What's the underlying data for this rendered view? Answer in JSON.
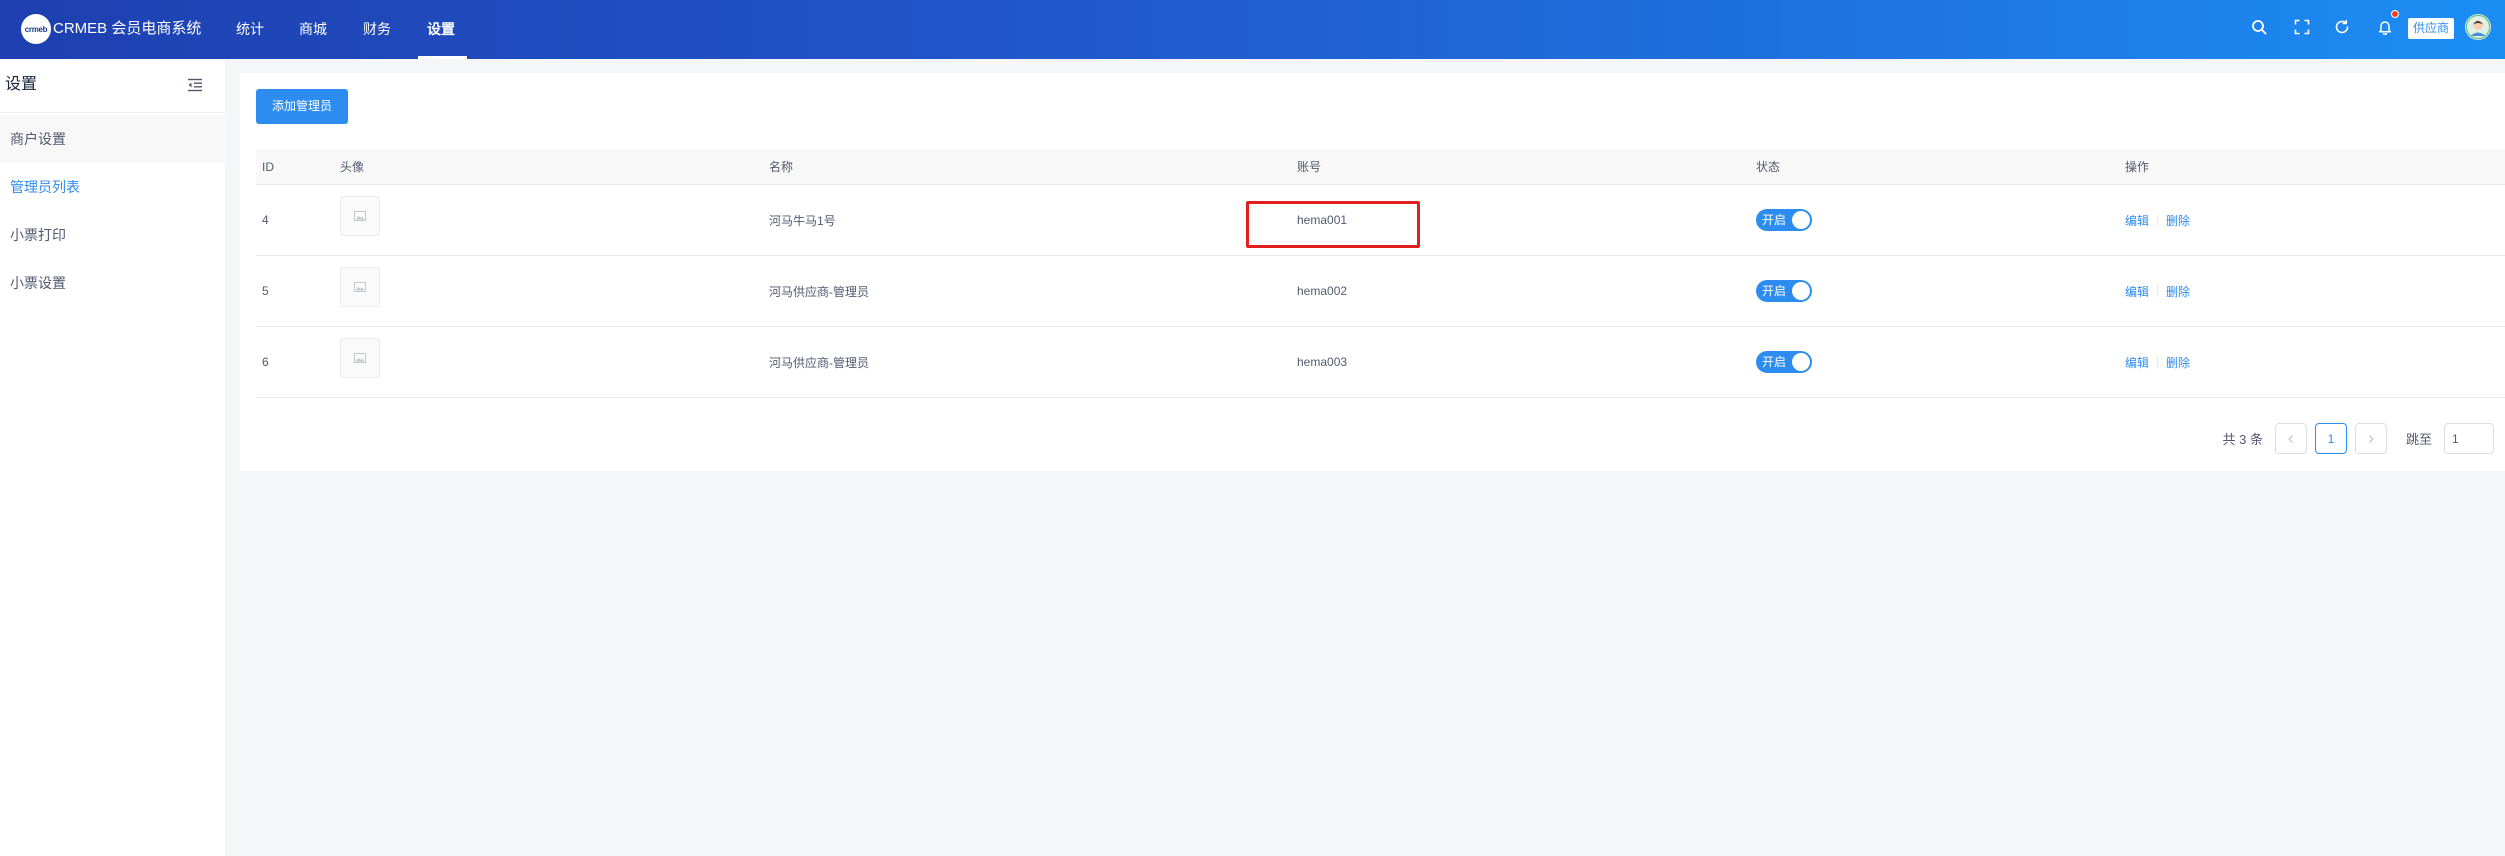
{
  "app": {
    "logo_text": "crmeb",
    "title": "CRMEB 会员电商系统"
  },
  "colors": {
    "header_gradient_start": "#1e40b0",
    "header_gradient_end": "#1b8ef4",
    "accent": "#2d8cf0",
    "notification_dot": "#ed4014",
    "highlight_box": "#e31e1e"
  },
  "top_nav": {
    "items": [
      {
        "label": "统计"
      },
      {
        "label": "商城"
      },
      {
        "label": "财务"
      },
      {
        "label": "设置",
        "active": true
      }
    ]
  },
  "header_actions": {
    "icons": [
      "search-icon",
      "fullscreen-icon",
      "refresh-icon",
      "bell-icon"
    ],
    "has_notification": true,
    "role_badge": "供应商",
    "avatar_icon": "user-avatar"
  },
  "sidebar": {
    "title": "设置",
    "collapse_icon": "menu-fold-icon",
    "items": [
      {
        "label": "商户设置"
      },
      {
        "label": "管理员列表",
        "active": true
      },
      {
        "label": "小票打印"
      },
      {
        "label": "小票设置"
      }
    ]
  },
  "toolbar": {
    "add_label": "添加管理员"
  },
  "table": {
    "columns": [
      "ID",
      "头像",
      "名称",
      "账号",
      "状态",
      "操作"
    ],
    "rows": [
      {
        "id": "4",
        "avatar_icon": "image-placeholder-icon",
        "name": "河马牛马1号",
        "account": "hema001",
        "account_highlighted": true,
        "status": {
          "enabled": true,
          "label": "开启"
        },
        "actions": [
          "编辑",
          "删除"
        ]
      },
      {
        "id": "5",
        "avatar_icon": "image-placeholder-icon",
        "name": "河马供应商-管理员",
        "account": "hema002",
        "status": {
          "enabled": true,
          "label": "开启"
        },
        "actions": [
          "编辑",
          "删除"
        ]
      },
      {
        "id": "6",
        "avatar_icon": "image-placeholder-icon",
        "name": "河马供应商-管理员",
        "account": "hema003",
        "status": {
          "enabled": true,
          "label": "开启"
        },
        "actions": [
          "编辑",
          "删除"
        ]
      }
    ]
  },
  "pagination": {
    "total_text": "共 3 条",
    "current_page": "1",
    "prev_icon": "chevron-left-icon",
    "next_icon": "chevron-right-icon",
    "jump_label": "跳至",
    "jump_value": "1"
  }
}
